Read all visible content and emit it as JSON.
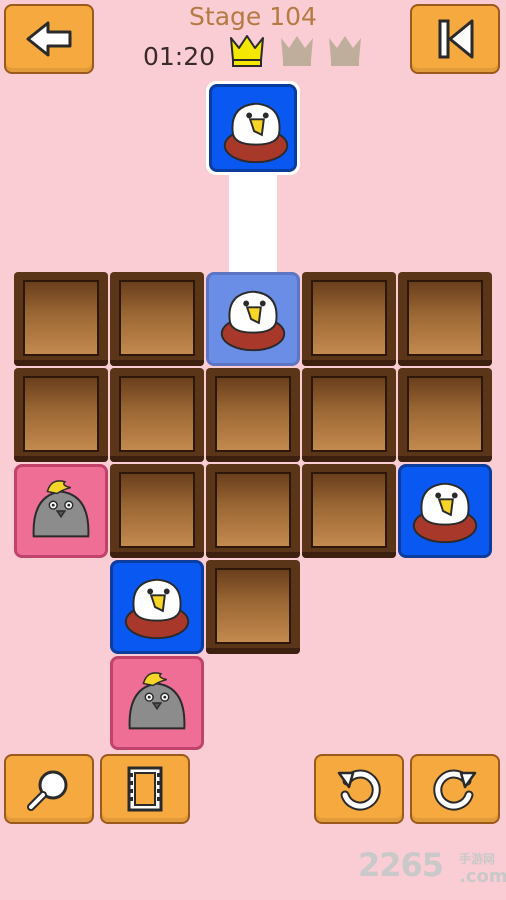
{
  "header": {
    "stage_label": "Stage 104",
    "timer": "01:20",
    "crowns_earned": 1,
    "crowns_total": 3
  },
  "colors": {
    "background": "#f9cdd3",
    "button": "#f5a93f",
    "crown_gold": "#f4e800",
    "crown_gray": "#bfae9c",
    "tile_blue": "#0a58f2",
    "tile_pink": "#ee6e96"
  },
  "buttons": {
    "back": "arrow-left-icon",
    "restart": "skip-to-start-icon",
    "hint": "magnifier-icon",
    "replay": "film-strip-icon",
    "undo": "undo-icon",
    "redo": "redo-icon"
  },
  "watermark": {
    "number": "2265",
    "cn": "手游网",
    "domain": ".com"
  }
}
